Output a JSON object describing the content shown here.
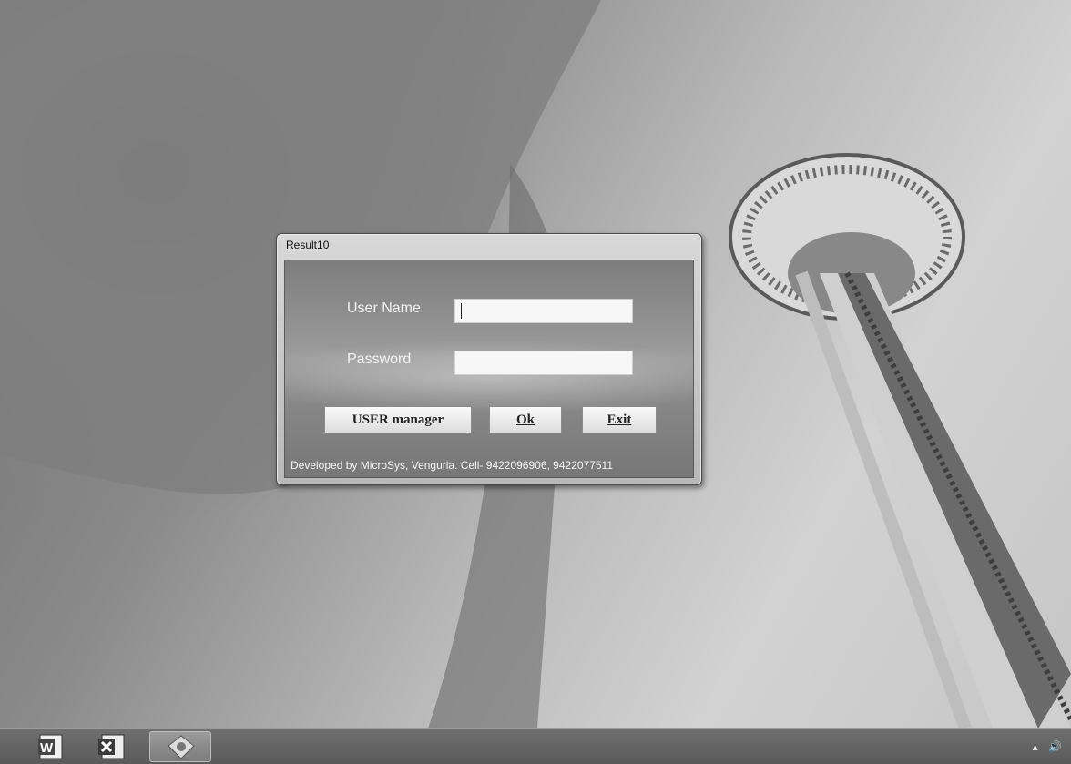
{
  "window": {
    "title": "Result10"
  },
  "form": {
    "username_label": "User Name",
    "username_value": "",
    "password_label": "Password",
    "password_value": ""
  },
  "buttons": {
    "user_manager": "USER manager",
    "ok": "Ok",
    "exit": "Exit"
  },
  "footer": {
    "text": "Developed by MicroSys, Vengurla. Cell- 9422096906, 9422077511"
  },
  "taskbar": {
    "items": [
      {
        "icon": "word-icon",
        "active": false
      },
      {
        "icon": "excel-icon",
        "active": false
      },
      {
        "icon": "app-icon",
        "active": true
      }
    ],
    "tray_icons": [
      "show-hidden-icons-arrow",
      "speaker-icon"
    ]
  }
}
